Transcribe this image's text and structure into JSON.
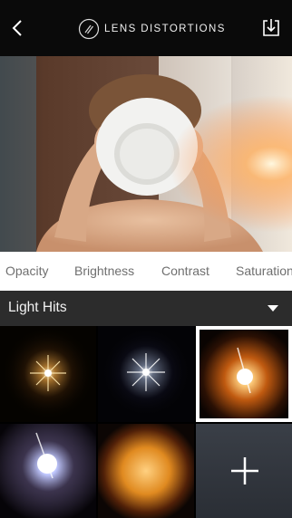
{
  "header": {
    "title": "LENS DISTORTIONS",
    "back_icon": "chevron-left-icon",
    "logo_icon": "lens-distortions-logo",
    "download_icon": "download-icon"
  },
  "photo": {
    "subject": "photo"
  },
  "adjustments": {
    "items": [
      {
        "label": "Opacity"
      },
      {
        "label": "Brightness"
      },
      {
        "label": "Contrast"
      },
      {
        "label": "Saturation"
      }
    ]
  },
  "category": {
    "label": "Light Hits",
    "dropdown_icon": "caret-down-icon"
  },
  "filters": {
    "selected_index": 2,
    "add_icon": "plus-icon",
    "accent_color": "#ffffff"
  }
}
